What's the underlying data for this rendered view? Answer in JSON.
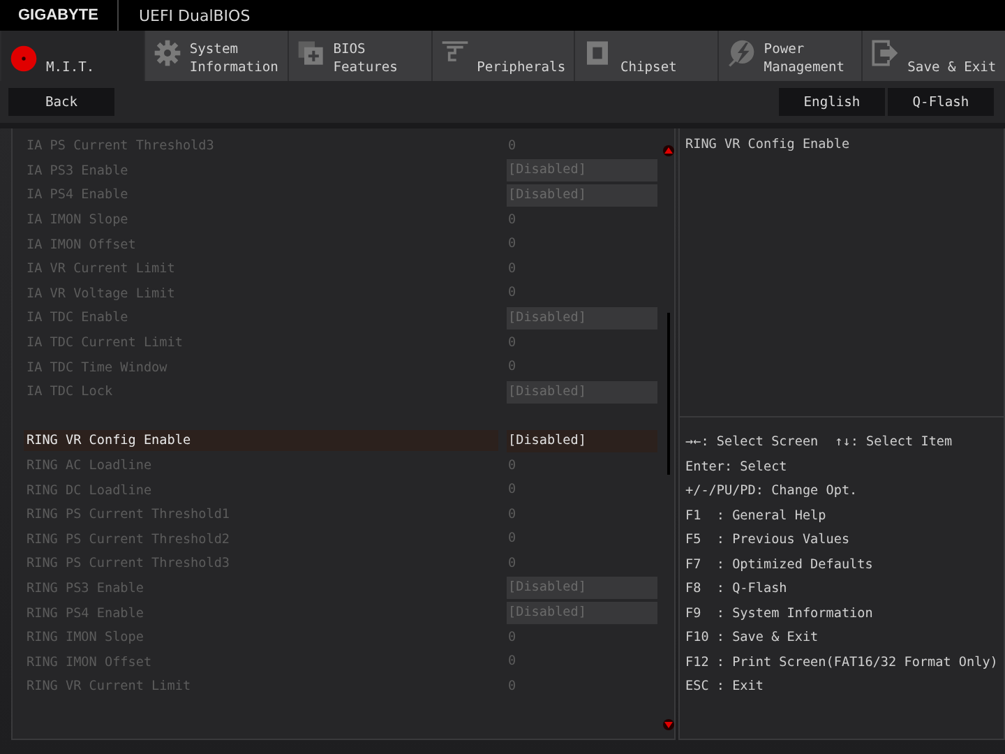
{
  "header": {
    "brand": "GIGABYTE",
    "title": "UEFI DualBIOS"
  },
  "tabs": [
    {
      "label": "M.I.T.",
      "selected": true
    },
    {
      "label": "System\nInformation",
      "selected": false
    },
    {
      "label": "BIOS\nFeatures",
      "selected": false
    },
    {
      "label": "Peripherals",
      "selected": false
    },
    {
      "label": "Chipset",
      "selected": false
    },
    {
      "label": "Power\nManagement",
      "selected": false
    },
    {
      "label": "Save & Exit",
      "selected": false
    }
  ],
  "toolbar": {
    "back": "Back",
    "buttons": [
      "English",
      "Q-Flash"
    ]
  },
  "settings": [
    {
      "items": [
        {
          "label": "IA PS Current Threshold3",
          "value": "0",
          "kind": "number",
          "selected": false
        },
        {
          "label": "IA PS3 Enable",
          "value": "[Disabled]",
          "kind": "option",
          "selected": false
        },
        {
          "label": "IA PS4 Enable",
          "value": "[Disabled]",
          "kind": "option",
          "selected": false
        },
        {
          "label": "IA IMON Slope",
          "value": "0",
          "kind": "number",
          "selected": false
        },
        {
          "label": "IA IMON Offset",
          "value": "0",
          "kind": "number",
          "selected": false
        },
        {
          "label": "IA VR Current Limit",
          "value": "0",
          "kind": "number",
          "selected": false
        },
        {
          "label": "IA VR Voltage Limit",
          "value": "0",
          "kind": "number",
          "selected": false
        },
        {
          "label": "IA TDC Enable",
          "value": "[Disabled]",
          "kind": "option",
          "selected": false
        },
        {
          "label": "IA TDC Current Limit",
          "value": "0",
          "kind": "number",
          "selected": false
        },
        {
          "label": "IA TDC Time Window",
          "value": "0",
          "kind": "number",
          "selected": false
        },
        {
          "label": "IA TDC Lock",
          "value": "[Disabled]",
          "kind": "option",
          "selected": false
        }
      ]
    },
    {
      "items": [
        {
          "label": "RING VR Config Enable",
          "value": "[Disabled]",
          "kind": "option",
          "selected": true
        },
        {
          "label": "RING AC Loadline",
          "value": "0",
          "kind": "number",
          "selected": false
        },
        {
          "label": "RING DC Loadline",
          "value": "0",
          "kind": "number",
          "selected": false
        },
        {
          "label": "RING PS Current Threshold1",
          "value": "0",
          "kind": "number",
          "selected": false
        },
        {
          "label": "RING PS Current Threshold2",
          "value": "0",
          "kind": "number",
          "selected": false
        },
        {
          "label": "RING PS Current Threshold3",
          "value": "0",
          "kind": "number",
          "selected": false
        },
        {
          "label": "RING PS3 Enable",
          "value": "[Disabled]",
          "kind": "option",
          "selected": false
        },
        {
          "label": "RING PS4 Enable",
          "value": "[Disabled]",
          "kind": "option",
          "selected": false
        },
        {
          "label": "RING IMON Slope",
          "value": "0",
          "kind": "number",
          "selected": false
        },
        {
          "label": "RING IMON Offset",
          "value": "0",
          "kind": "number",
          "selected": false
        },
        {
          "label": "RING VR Current Limit",
          "value": "0",
          "kind": "number",
          "selected": false
        }
      ]
    }
  ],
  "help": {
    "description": "RING VR Config Enable",
    "nav": [
      "→←: Select Screen",
      "↑↓: Select Item"
    ],
    "keys": [
      "Enter: Select",
      "+/-/PU/PD: Change Opt.",
      "F1  : General Help",
      "F5  : Previous Values",
      "F7  : Optimized Defaults",
      "F8  : Q-Flash",
      "F9  : System Information",
      "F10 : Save & Exit",
      "F12 : Print Screen(FAT16/32 Format Only)",
      "ESC : Exit"
    ]
  }
}
